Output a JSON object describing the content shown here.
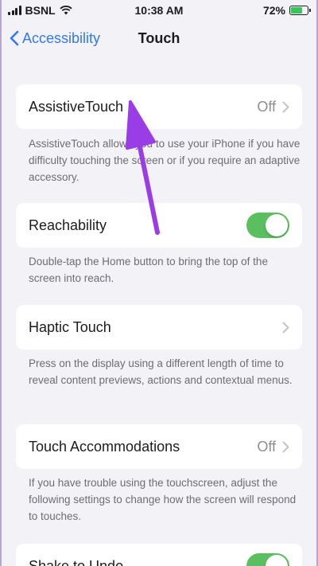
{
  "status_bar": {
    "carrier": "BSNL",
    "time": "10:38 AM",
    "battery_percent": "72%",
    "battery_level": 0.72
  },
  "nav": {
    "back_label": "Accessibility",
    "title": "Touch"
  },
  "rows": {
    "assistive_touch": {
      "label": "AssistiveTouch",
      "value": "Off",
      "footer": "AssistiveTouch allows you to use your iPhone if you have difficulty touching the screen or if you require an adaptive accessory."
    },
    "reachability": {
      "label": "Reachability",
      "toggle": "on",
      "footer": "Double-tap the Home button to bring the top of the screen into reach."
    },
    "haptic_touch": {
      "label": "Haptic Touch",
      "footer": "Press on the display using a different length of time to reveal content previews, actions and contextual menus."
    },
    "touch_accommodations": {
      "label": "Touch Accommodations",
      "value": "Off",
      "footer": "If you have trouble using the touchscreen, adjust the following settings to change how the screen will respond to touches."
    },
    "shake_to_undo": {
      "label": "Shake to Undo",
      "toggle": "on"
    }
  },
  "colors": {
    "accent": "#3478f6",
    "toggle_on": "#5ac05f",
    "annotation_arrow": "#9b3de6"
  }
}
